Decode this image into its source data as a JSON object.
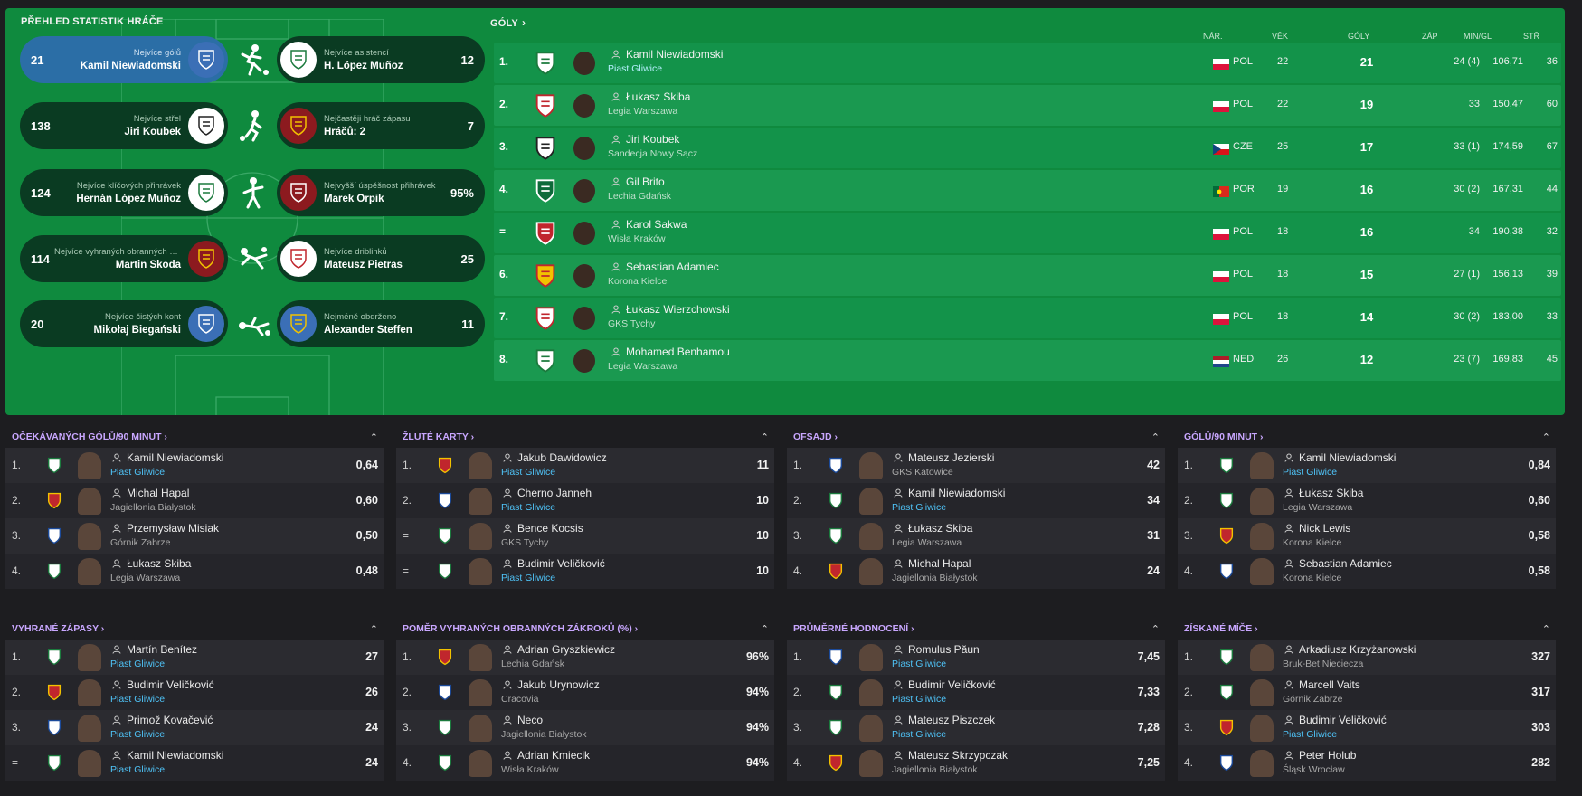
{
  "overview": {
    "title": "PŘEHLED STATISTIK HRÁČE",
    "left": [
      {
        "value": "21",
        "caption": "Nejvíce gólů",
        "name": "Kamil Niewiadomski",
        "active": true
      },
      {
        "value": "138",
        "caption": "Nejvíce střel",
        "name": "Jiri Koubek"
      },
      {
        "value": "124",
        "caption": "Nejvíce klíčových přihrávek",
        "name": "Hernán López Muñoz"
      },
      {
        "value": "114",
        "caption": "Nejvíce vyhraných obranných zákroků",
        "name": "Martin Skoda"
      },
      {
        "value": "20",
        "caption": "Nejvíce čistých kont",
        "name": "Mikołaj Biegański"
      }
    ],
    "right": [
      {
        "value": "12",
        "caption": "Nejvíce asistencí",
        "name": "H. López Muñoz"
      },
      {
        "value": "7",
        "caption": "Nejčastěji hráč zápasu",
        "name": "Hráčů: 2"
      },
      {
        "value": "95%",
        "caption": "Nejvyšší úspěšnost přihrávek",
        "name": "Marek Orpik"
      },
      {
        "value": "25",
        "caption": "Nejvíce driblinků",
        "name": "Mateusz Pietras"
      },
      {
        "value": "11",
        "caption": "Nejméně obdrženo",
        "name": "Alexander Steffen"
      }
    ]
  },
  "goals": {
    "title": "GÓLY",
    "headers": {
      "nat": "NÁR.",
      "age": "VĚK",
      "goals": "GÓLY",
      "apps": "ZÁP",
      "mpg": "MIN/GL",
      "shots": "STŘ"
    },
    "rows": [
      {
        "rank": "1.",
        "name": "Kamil Niewiadomski",
        "club": "Piast Gliwice",
        "hl": true,
        "nat": "POL",
        "age": "22",
        "goals": "21",
        "apps": "24 (4)",
        "mpg": "106,71",
        "shots": "36"
      },
      {
        "rank": "2.",
        "name": "Łukasz Skiba",
        "club": "Legia Warszawa",
        "nat": "POL",
        "age": "22",
        "goals": "19",
        "apps": "33",
        "mpg": "150,47",
        "shots": "60"
      },
      {
        "rank": "3.",
        "name": "Jiri Koubek",
        "club": "Sandecja Nowy Sącz",
        "nat": "CZE",
        "age": "25",
        "goals": "17",
        "apps": "33 (1)",
        "mpg": "174,59",
        "shots": "67"
      },
      {
        "rank": "4.",
        "name": "Gil Brito",
        "club": "Lechia Gdańsk",
        "nat": "POR",
        "age": "19",
        "goals": "16",
        "apps": "30 (2)",
        "mpg": "167,31",
        "shots": "44"
      },
      {
        "rank": "=",
        "name": "Karol Sakwa",
        "club": "Wisła Kraków",
        "nat": "POL",
        "age": "18",
        "goals": "16",
        "apps": "34",
        "mpg": "190,38",
        "shots": "32"
      },
      {
        "rank": "6.",
        "name": "Sebastian Adamiec",
        "club": "Korona Kielce",
        "nat": "POL",
        "age": "18",
        "goals": "15",
        "apps": "27 (1)",
        "mpg": "156,13",
        "shots": "39"
      },
      {
        "rank": "7.",
        "name": "Łukasz Wierzchowski",
        "club": "GKS Tychy",
        "nat": "POL",
        "age": "18",
        "goals": "14",
        "apps": "30 (2)",
        "mpg": "183,00",
        "shots": "33"
      },
      {
        "rank": "8.",
        "name": "Mohamed Benhamou",
        "club": "Legia Warszawa",
        "nat": "NED",
        "age": "26",
        "goals": "12",
        "apps": "23 (7)",
        "mpg": "169,83",
        "shots": "45"
      }
    ]
  },
  "tables": [
    {
      "title": "OČEKÁVANÝCH GÓLŮ/90 MINUT",
      "rows": [
        {
          "rank": "1.",
          "name": "Kamil Niewiadomski",
          "club": "Piast Gliwice",
          "hl": true,
          "value": "0,64"
        },
        {
          "rank": "2.",
          "name": "Michal Hapal",
          "club": "Jagiellonia Białystok",
          "value": "0,60"
        },
        {
          "rank": "3.",
          "name": "Przemysław Misiak",
          "club": "Górnik Zabrze",
          "value": "0,50"
        },
        {
          "rank": "4.",
          "name": "Łukasz Skiba",
          "club": "Legia Warszawa",
          "value": "0,48"
        }
      ]
    },
    {
      "title": "ŽLUTÉ KARTY",
      "rows": [
        {
          "rank": "1.",
          "name": "Jakub Dawidowicz",
          "club": "Piast Gliwice",
          "hl": true,
          "value": "11"
        },
        {
          "rank": "2.",
          "name": "Cherno Janneh",
          "club": "Piast Gliwice",
          "hl": true,
          "value": "10"
        },
        {
          "rank": "=",
          "name": "Bence Kocsis",
          "club": "GKS Tychy",
          "value": "10"
        },
        {
          "rank": "=",
          "name": "Budimir Veličković",
          "club": "Piast Gliwice",
          "hl": true,
          "value": "10"
        }
      ]
    },
    {
      "title": "OFSAJD",
      "rows": [
        {
          "rank": "1.",
          "name": "Mateusz Jezierski",
          "club": "GKS Katowice",
          "value": "42"
        },
        {
          "rank": "2.",
          "name": "Kamil Niewiadomski",
          "club": "Piast Gliwice",
          "hl": true,
          "value": "34"
        },
        {
          "rank": "3.",
          "name": "Łukasz Skiba",
          "club": "Legia Warszawa",
          "value": "31"
        },
        {
          "rank": "4.",
          "name": "Michal Hapal",
          "club": "Jagiellonia Białystok",
          "value": "24"
        }
      ]
    },
    {
      "title": "GÓLŮ/90 MINUT",
      "rows": [
        {
          "rank": "1.",
          "name": "Kamil Niewiadomski",
          "club": "Piast Gliwice",
          "hl": true,
          "value": "0,84"
        },
        {
          "rank": "2.",
          "name": "Łukasz Skiba",
          "club": "Legia Warszawa",
          "value": "0,60"
        },
        {
          "rank": "3.",
          "name": "Nick Lewis",
          "club": "Korona Kielce",
          "value": "0,58"
        },
        {
          "rank": "4.",
          "name": "Sebastian Adamiec",
          "club": "Korona Kielce",
          "value": "0,58"
        }
      ]
    },
    {
      "title": "VYHRANÉ ZÁPASY",
      "rows": [
        {
          "rank": "1.",
          "name": "Martín Benítez",
          "club": "Piast Gliwice",
          "hl": true,
          "value": "27"
        },
        {
          "rank": "2.",
          "name": "Budimir Veličković",
          "club": "Piast Gliwice",
          "hl": true,
          "value": "26"
        },
        {
          "rank": "3.",
          "name": "Primož Kovačević",
          "club": "Piast Gliwice",
          "hl": true,
          "value": "24"
        },
        {
          "rank": "=",
          "name": "Kamil Niewiadomski",
          "club": "Piast Gliwice",
          "hl": true,
          "value": "24"
        }
      ]
    },
    {
      "title": "POMĚR VYHRANÝCH OBRANNÝCH ZÁKROKŮ (%)",
      "rows": [
        {
          "rank": "1.",
          "name": "Adrian Gryszkiewicz",
          "club": "Lechia Gdańsk",
          "value": "96%"
        },
        {
          "rank": "2.",
          "name": "Jakub Urynowicz",
          "club": "Cracovia",
          "value": "94%"
        },
        {
          "rank": "3.",
          "name": "Neco",
          "club": "Jagiellonia Białystok",
          "value": "94%"
        },
        {
          "rank": "4.",
          "name": "Adrian Kmiecik",
          "club": "Wisła Kraków",
          "value": "94%"
        }
      ]
    },
    {
      "title": "PRŮMĚRNÉ HODNOCENÍ",
      "rows": [
        {
          "rank": "1.",
          "name": "Romulus Păun",
          "club": "Piast Gliwice",
          "hl": true,
          "value": "7,45"
        },
        {
          "rank": "2.",
          "name": "Budimir Veličković",
          "club": "Piast Gliwice",
          "hl": true,
          "value": "7,33"
        },
        {
          "rank": "3.",
          "name": "Mateusz Piszczek",
          "club": "Piast Gliwice",
          "hl": true,
          "value": "7,28"
        },
        {
          "rank": "4.",
          "name": "Mateusz Skrzypczak",
          "club": "Jagiellonia Białystok",
          "value": "7,25"
        }
      ]
    },
    {
      "title": "ZÍSKANÉ MÍČE",
      "rows": [
        {
          "rank": "1.",
          "name": "Arkadiusz Krzyżanowski",
          "club": "Bruk-Bet Nieciecza",
          "value": "327"
        },
        {
          "rank": "2.",
          "name": "Marcell Vaits",
          "club": "Górnik Zabrze",
          "value": "317"
        },
        {
          "rank": "3.",
          "name": "Budimir Veličković",
          "club": "Piast Gliwice",
          "hl": true,
          "value": "303"
        },
        {
          "rank": "4.",
          "name": "Peter Holub",
          "club": "Śląsk Wrocław",
          "value": "282"
        }
      ]
    }
  ],
  "colors": {
    "panel": "#0f8a3e",
    "accent": "#c9a7ff",
    "link": "#4fc3f7",
    "background": "#1d1d20"
  }
}
